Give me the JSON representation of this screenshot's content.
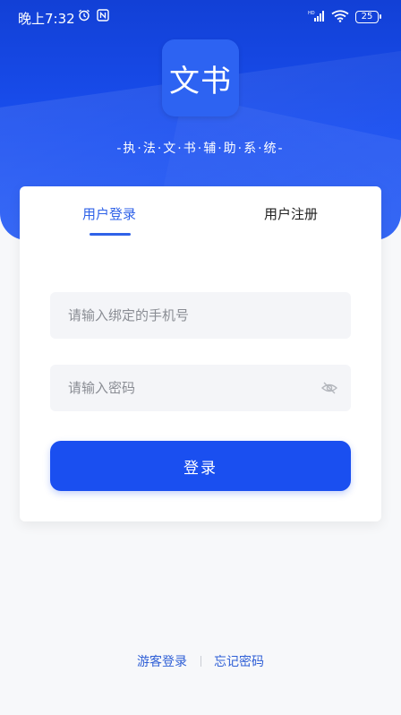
{
  "status_bar": {
    "time": "晚上7:32",
    "battery": "25"
  },
  "header": {
    "logo_text": "文书",
    "slogan": "-执·法·文·书·辅·助·系·统-"
  },
  "tabs": {
    "login": "用户登录",
    "register": "用户注册"
  },
  "form": {
    "phone_placeholder": "请输入绑定的手机号",
    "password_placeholder": "请输入密码",
    "submit_label": "登录"
  },
  "footer": {
    "guest_login": "游客登录",
    "forgot_password": "忘记密码"
  },
  "colors": {
    "primary": "#1a4ff0",
    "tab_active": "#2f62e8",
    "link": "#2f5fd6"
  },
  "icons": {
    "status": [
      "alarm-icon",
      "nfc-icon",
      "signal-icon",
      "wifi-icon",
      "battery-icon"
    ],
    "password_toggle": "eye-hidden-icon"
  }
}
